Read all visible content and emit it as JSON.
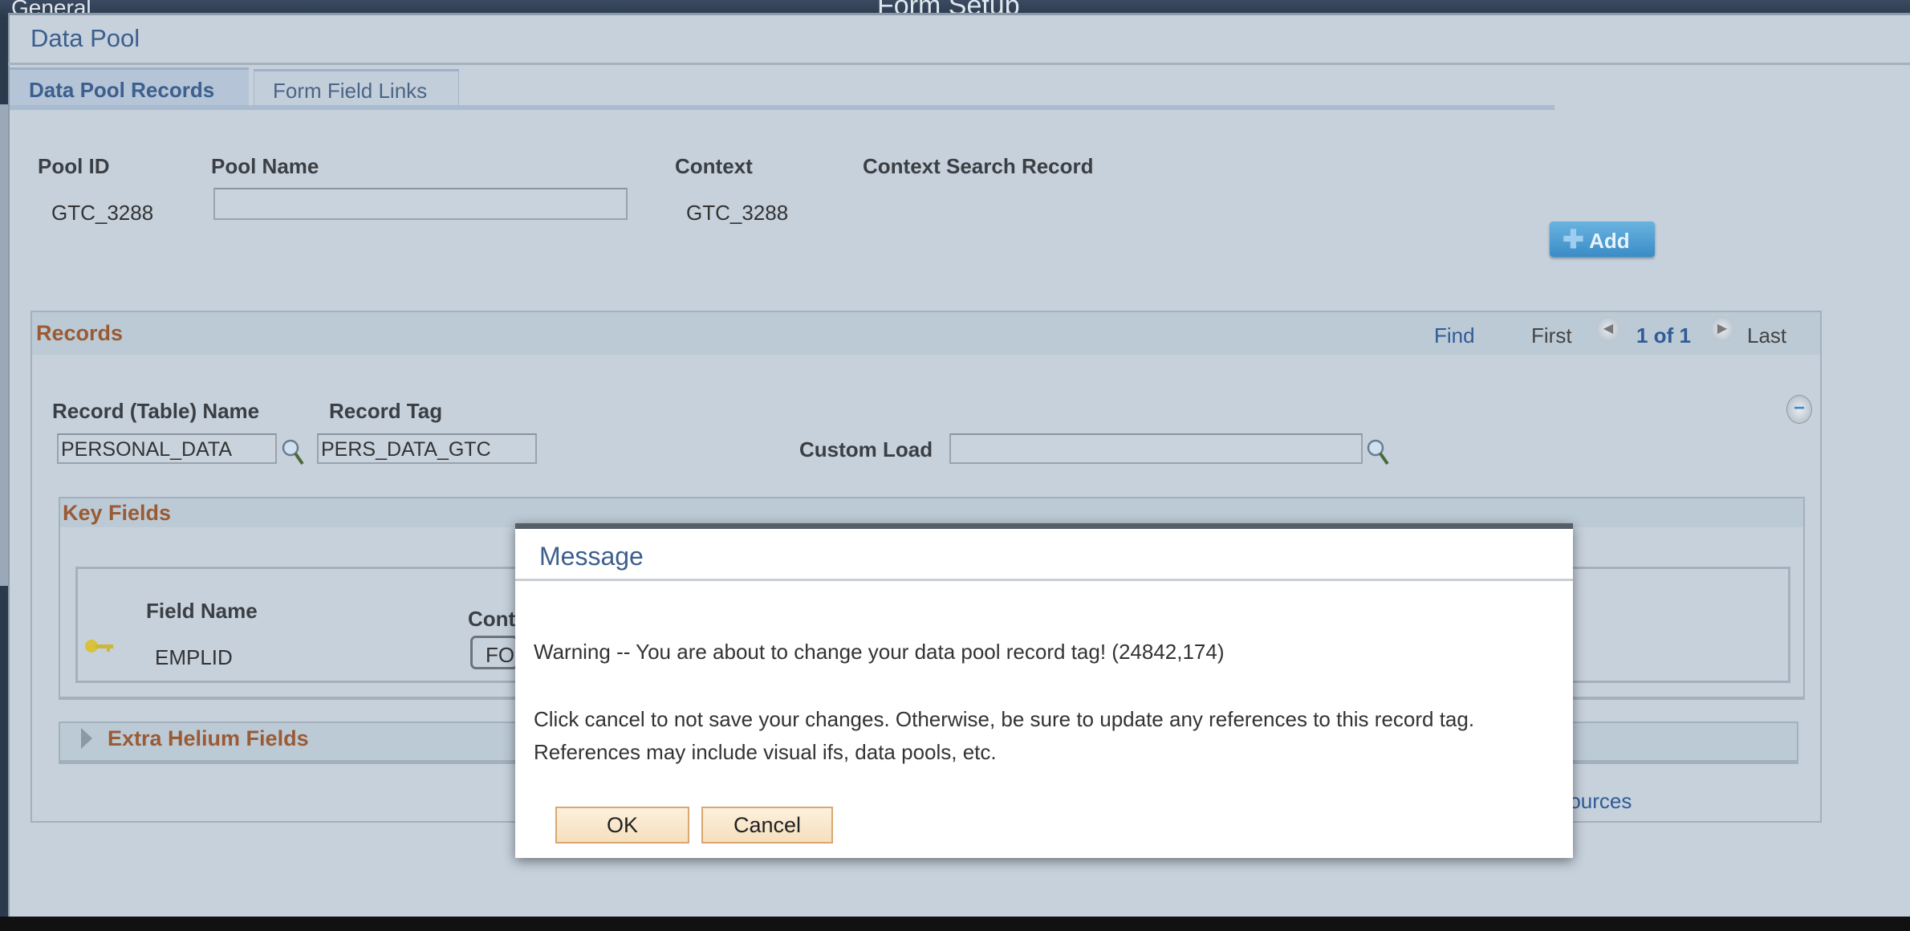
{
  "app": {
    "left_tab": "General",
    "title": "Form Setup"
  },
  "page": {
    "title": "Data Pool",
    "tabs": [
      {
        "label": "Data Pool Records",
        "active": true
      },
      {
        "label": "Form Field Links",
        "active": false
      }
    ]
  },
  "header_fields": {
    "pool_id_label": "Pool ID",
    "pool_id": "GTC_3288",
    "pool_name_label": "Pool Name",
    "pool_name": "",
    "context_label": "Context",
    "context": "GTC_3288",
    "context_search_label": "Context Search Record",
    "add_label": "Add"
  },
  "records": {
    "title": "Records",
    "find": "Find",
    "first": "First",
    "pager": "1 of 1",
    "last": "Last",
    "record_name_label": "Record (Table) Name",
    "record_name": "PERSONAL_DATA",
    "record_tag_label": "Record Tag",
    "record_tag": "PERS_DATA_GTC",
    "custom_load_label": "Custom Load",
    "custom_load": "",
    "key_fields": {
      "title": "Key Fields",
      "field_name_label": "Field Name",
      "field_name": "EMPLID",
      "context_label": "Cont",
      "context_button": "FO"
    },
    "extra_title": "Extra Helium Fields",
    "sources_link": "Sources"
  },
  "dialog": {
    "title": "Message",
    "warning": "Warning -- You are about to change your data pool record tag! (24842,174)",
    "line2": "Click cancel to not save your changes. Otherwise, be sure to update any references to this record tag.",
    "line3": "References may include visual ifs, data pools, etc.",
    "ok": "OK",
    "cancel": "Cancel"
  },
  "colors": {
    "panel": "#c6d1dc",
    "heading": "#9a5b34",
    "title": "#3c5f8e",
    "link": "#2f5c96"
  }
}
